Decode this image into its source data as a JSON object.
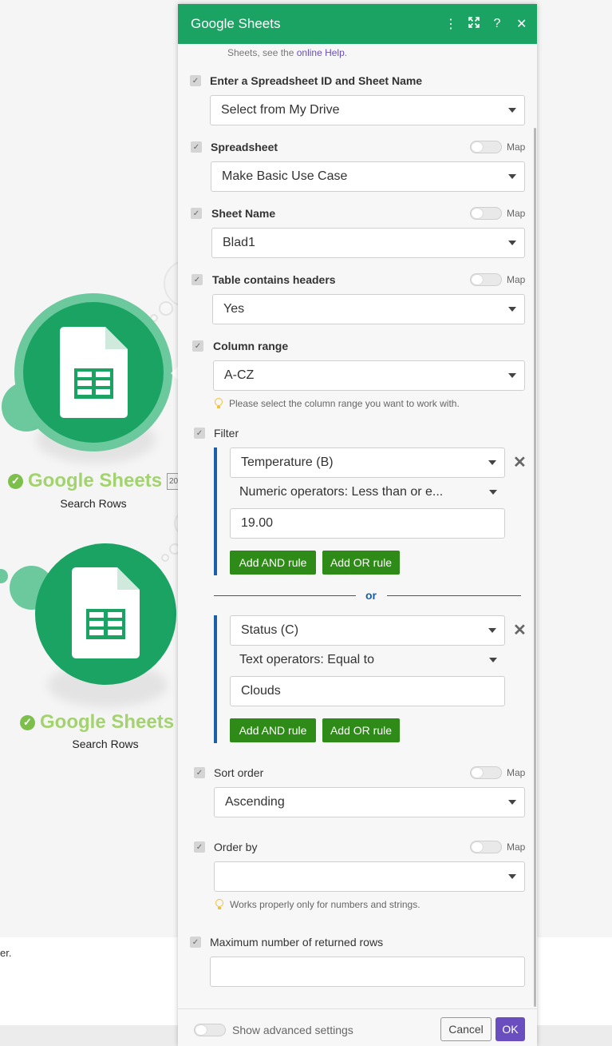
{
  "canvas": {
    "modules": [
      {
        "title": "Google Sheets",
        "subtitle": "Search Rows"
      },
      {
        "title": "Google Sheets",
        "subtitle": "Search Rows"
      }
    ],
    "clip_badge": "20",
    "bottom_text": "er."
  },
  "panel": {
    "title": "Google Sheets",
    "header_icons": [
      "more-icon",
      "expand-icon",
      "help-icon",
      "close-icon"
    ],
    "help": {
      "prefix": "Sheets, see the ",
      "link": "online Help",
      "suffix": "."
    },
    "map_label": "Map",
    "fields": {
      "spreadsheet_id": {
        "label": "Enter a Spreadsheet ID and Sheet Name",
        "value": "Select from My Drive"
      },
      "spreadsheet": {
        "label": "Spreadsheet",
        "value": "Make Basic Use Case"
      },
      "sheet_name": {
        "label": "Sheet Name",
        "value": "Blad1"
      },
      "headers": {
        "label": "Table contains headers",
        "value": "Yes"
      },
      "column_range": {
        "label": "Column range",
        "value": "A-CZ",
        "hint": "Please select the column range you want to work with."
      },
      "filter": {
        "label": "Filter",
        "groups": [
          {
            "column": "Temperature (B)",
            "operator": "Numeric operators: Less than or e...",
            "value": "19.00"
          },
          {
            "column": "Status (C)",
            "operator": "Text operators: Equal to",
            "value": "Clouds"
          }
        ],
        "and_label": "Add AND rule",
        "or_label": "Add OR rule",
        "or_divider": "or"
      },
      "sort_order": {
        "label": "Sort order",
        "value": "Ascending"
      },
      "order_by": {
        "label": "Order by",
        "value": "",
        "hint": "Works properly only for numbers and strings."
      },
      "max_rows": {
        "label": "Maximum number of returned rows",
        "value": ""
      }
    },
    "footer": {
      "advanced_label": "Show advanced settings",
      "cancel": "Cancel",
      "ok": "OK"
    }
  },
  "colors": {
    "brand": "#1ba364",
    "accent": "#6a4dbf",
    "filter_bar": "#1a5fa8",
    "rule_button": "#2e8b17"
  }
}
